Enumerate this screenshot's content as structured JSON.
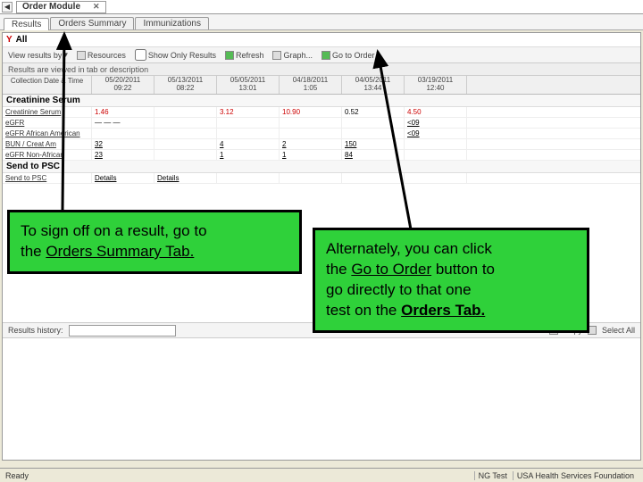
{
  "window": {
    "title_tab": "Order Module"
  },
  "tabs": [
    "Results",
    "Orders Summary",
    "Immunizations"
  ],
  "filter": {
    "all": "All"
  },
  "toolbar": {
    "view_results": "View results by",
    "resources": "Resources",
    "show_only": "Show Only Results",
    "refresh": "Refresh",
    "graph": "Graph...",
    "go_order": "Go to Order"
  },
  "subheader": "Results are viewed in tab or description",
  "grid": {
    "row_label": "Collection Date & Time",
    "cols": [
      {
        "d": "05/20/2011",
        "t": "09:22"
      },
      {
        "d": "05/13/2011",
        "t": "08:22"
      },
      {
        "d": "05/05/2011",
        "t": "13:01"
      },
      {
        "d": "04/18/2011",
        "t": "1:05"
      },
      {
        "d": "04/05/2011",
        "t": "13:44"
      },
      {
        "d": "03/19/2011",
        "t": "12:40"
      }
    ],
    "sections": [
      {
        "name": "Creatinine Serum",
        "rows": [
          {
            "label": "Creatinine Serum",
            "cells": [
              "1.46",
              "",
              "3.12",
              "10.90",
              "0.52",
              "4.50"
            ],
            "cls": [
              "red",
              "",
              "red",
              "red",
              "",
              "red"
            ]
          },
          {
            "label": "eGFR",
            "cells": [
              "— — —",
              "",
              "",
              "",
              "",
              "<09"
            ],
            "cls": [
              "",
              "",
              "",
              "",
              "",
              "ul"
            ]
          },
          {
            "label": "eGFR African American",
            "cells": [
              "",
              "",
              "",
              "",
              "",
              "<09"
            ],
            "cls": [
              "",
              "",
              "",
              "",
              "",
              "ul"
            ]
          },
          {
            "label": "BUN / Creat Am",
            "cells": [
              "32",
              "",
              "4",
              "2",
              "150",
              ""
            ],
            "cls": [
              "ul",
              "",
              "ul",
              "ul",
              "ul",
              ""
            ]
          },
          {
            "label": "eGFR Non-African",
            "cells": [
              "23",
              "",
              "1",
              "1",
              "84",
              ""
            ],
            "cls": [
              "ul",
              "",
              "ul",
              "ul",
              "ul",
              ""
            ]
          }
        ]
      },
      {
        "name": "Send to PSC",
        "rows": [
          {
            "label": "Send to PSC",
            "cells": [
              "Details",
              "Details",
              "",
              "",
              "",
              ""
            ],
            "cls": [
              "ul",
              "ul",
              "",
              "",
              "",
              ""
            ]
          }
        ]
      }
    ]
  },
  "history": {
    "label": "Results history:",
    "copy": "Copy",
    "select_all": "Select All"
  },
  "status": {
    "left": "Ready",
    "right1": "NG Test",
    "right2": "USA Health Services Foundation"
  },
  "callout1": {
    "l1": "To sign off on a result, go to",
    "l2a": "the ",
    "l2b": "Orders Summary Tab."
  },
  "callout2": {
    "l1": "Alternately, you can click",
    "l2a": "the ",
    "l2b": "Go to Order",
    "l2c": " button to",
    "l3": "go directly to that one",
    "l4a": "test on the ",
    "l4b": "Orders Tab."
  }
}
